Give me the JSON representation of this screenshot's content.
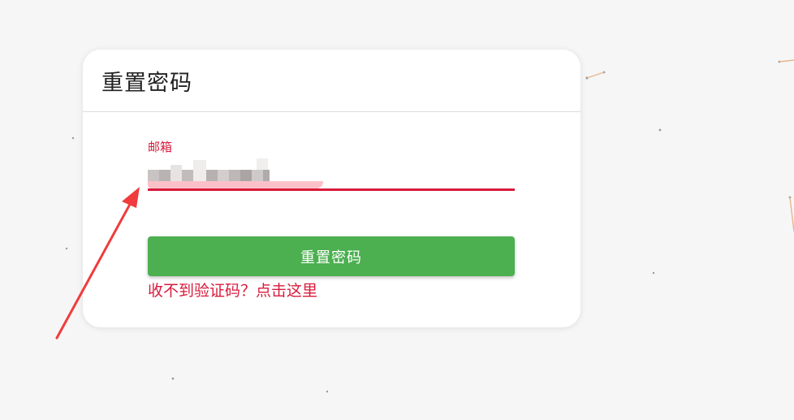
{
  "card": {
    "title": "重置密码"
  },
  "form": {
    "email_label": "邮箱",
    "email_value": "",
    "submit_label": "重置密码",
    "resend_link": "收不到验证码？点击这里"
  },
  "colors": {
    "accent": "#d81b3c",
    "button": "#4caf50",
    "background": "#f6f6f6",
    "annotation_arrow": "#f03c3c"
  }
}
